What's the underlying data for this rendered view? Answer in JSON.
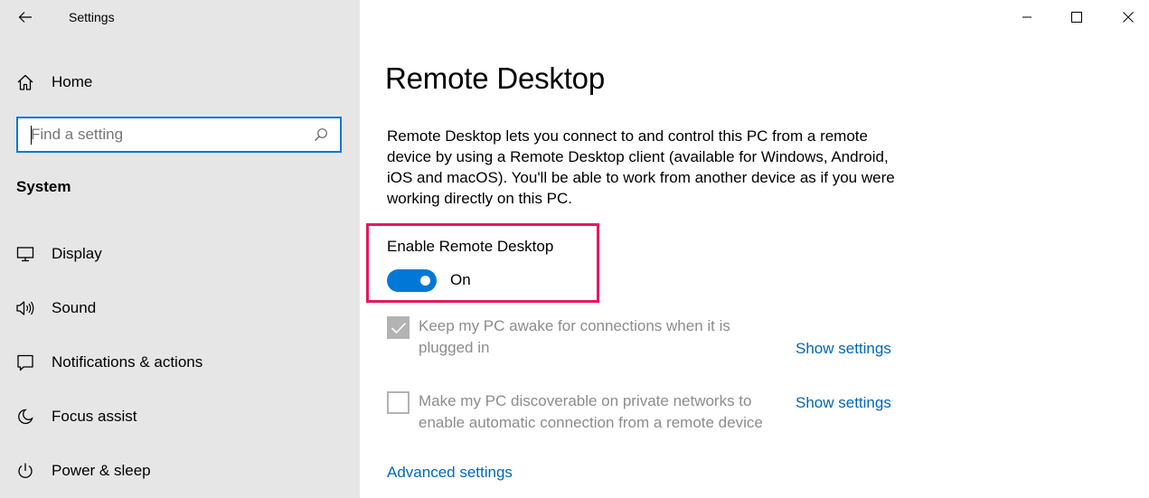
{
  "window": {
    "app_title": "Settings"
  },
  "sidebar": {
    "home_label": "Home",
    "search_placeholder": "Find a setting",
    "section_label": "System",
    "items": [
      {
        "label": "Display",
        "icon": "monitor-icon"
      },
      {
        "label": "Sound",
        "icon": "speaker-icon"
      },
      {
        "label": "Notifications & actions",
        "icon": "notification-icon"
      },
      {
        "label": "Focus assist",
        "icon": "moon-icon"
      },
      {
        "label": "Power & sleep",
        "icon": "power-icon"
      }
    ]
  },
  "main": {
    "title": "Remote Desktop",
    "description": "Remote Desktop lets you connect to and control this PC from a remote device by using a Remote Desktop client (available for Windows, Android, iOS and macOS). You'll be able to work from another device as if you were working directly on this PC.",
    "enable_label": "Enable Remote Desktop",
    "toggle_state": "On",
    "toggle_on": true,
    "options": [
      {
        "text": "Keep my PC awake for connections when it is plugged in",
        "checked": true,
        "link": "Show settings"
      },
      {
        "text": "Make my PC discoverable on private networks to enable automatic connection from a remote device",
        "checked": false,
        "link": "Show settings"
      }
    ],
    "advanced_link": "Advanced settings"
  },
  "colors": {
    "accent": "#0078d7",
    "link": "#0067b8",
    "highlight": "#e8175d",
    "sidebar_bg": "#e6e6e6",
    "disabled_text": "#8c8c8c"
  }
}
